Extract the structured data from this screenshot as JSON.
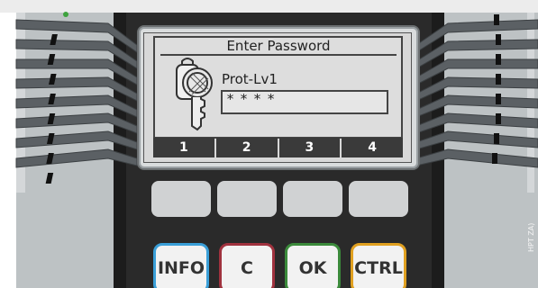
{
  "lcd": {
    "title": "Enter Password",
    "level": "Prot-Lv1",
    "password_mask": "****",
    "softkeys": [
      "1",
      "2",
      "3",
      "4"
    ]
  },
  "hardkeys": [
    {
      "label": "INFO",
      "color": "#3a9fd8"
    },
    {
      "label": "C",
      "color": "#a0323e"
    },
    {
      "label": "OK",
      "color": "#3b8a3b"
    },
    {
      "label": "CTRL",
      "color": "#e0a020"
    }
  ],
  "status_led_color": "#3ea33e",
  "watermark": "HPT ZA)",
  "icons": {
    "key": "key-icon"
  }
}
